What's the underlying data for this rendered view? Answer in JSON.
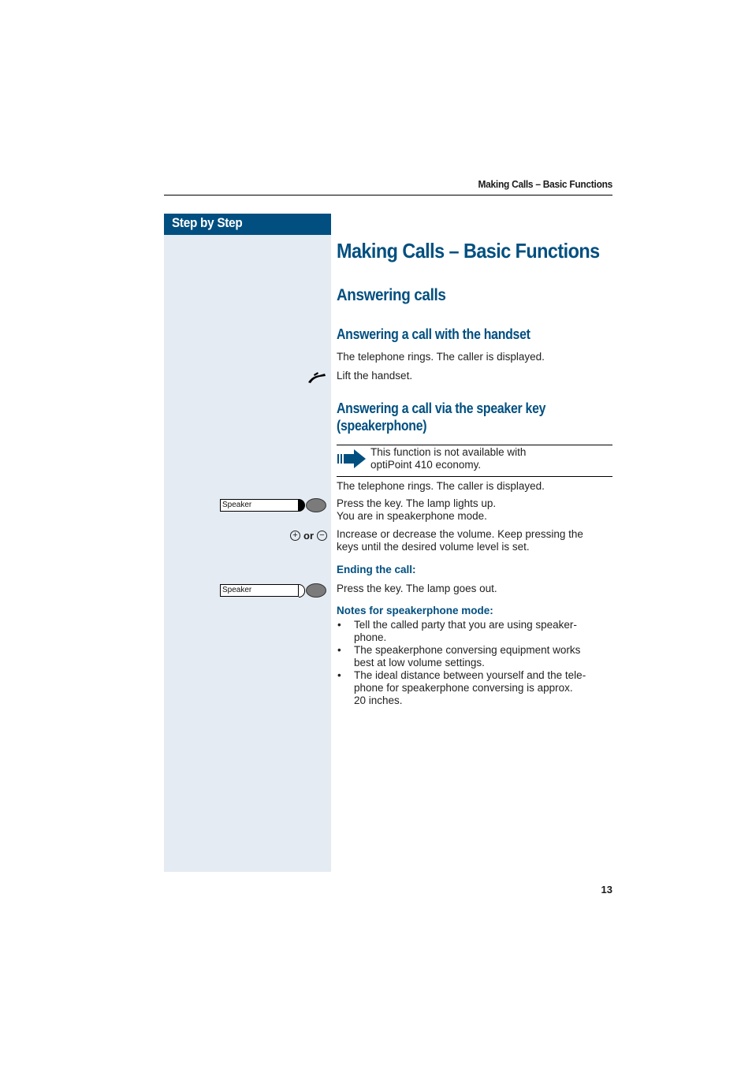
{
  "running_head": "Making Calls – Basic Functions",
  "sidebar": {
    "title": "Step by Step"
  },
  "main": {
    "title": "Making Calls – Basic Functions",
    "section_title": "Answering calls",
    "handset": {
      "heading": "Answering a call with the handset",
      "line1": "The telephone rings. The caller is displayed.",
      "step_icon": "lift-handset-icon",
      "step_text": "Lift the handset."
    },
    "speaker": {
      "heading_line1": "Answering a call via the speaker key",
      "heading_line2": "(speakerphone)",
      "note_icon": "note-arrow-icon",
      "note_line1": "This function is not available with",
      "note_line2": "optiPoint 410 economy.",
      "line1": "The telephone rings. The caller is displayed.",
      "key_label": "Speaker",
      "press_line1": "Press the key. The lamp lights up.",
      "press_line2": "You are in speakerphone mode.",
      "volume_plus": "+",
      "volume_or": "or",
      "volume_minus": "−",
      "volume_line1": "Increase or decrease the volume. Keep pressing the",
      "volume_line2": "keys until the desired volume level is set.",
      "ending_heading": "Ending the call:",
      "ending_key_label": "Speaker",
      "ending_text": "Press the key. The lamp goes out.",
      "notes_heading": "Notes for speakerphone mode:",
      "notes": [
        {
          "line1": "Tell the called party that you are using speaker-",
          "line2": "phone.",
          "line3": ""
        },
        {
          "line1": "The speakerphone conversing equipment works",
          "line2": "best at low volume settings.",
          "line3": ""
        },
        {
          "line1": "The ideal distance between yourself and the tele-",
          "line2": "phone for speakerphone conversing is approx.",
          "line3": "20 inches."
        }
      ],
      "bullet": "•"
    }
  },
  "page_number": "13",
  "colors": {
    "accent": "#004f80",
    "sidebar_bg": "#e4ebf3"
  }
}
